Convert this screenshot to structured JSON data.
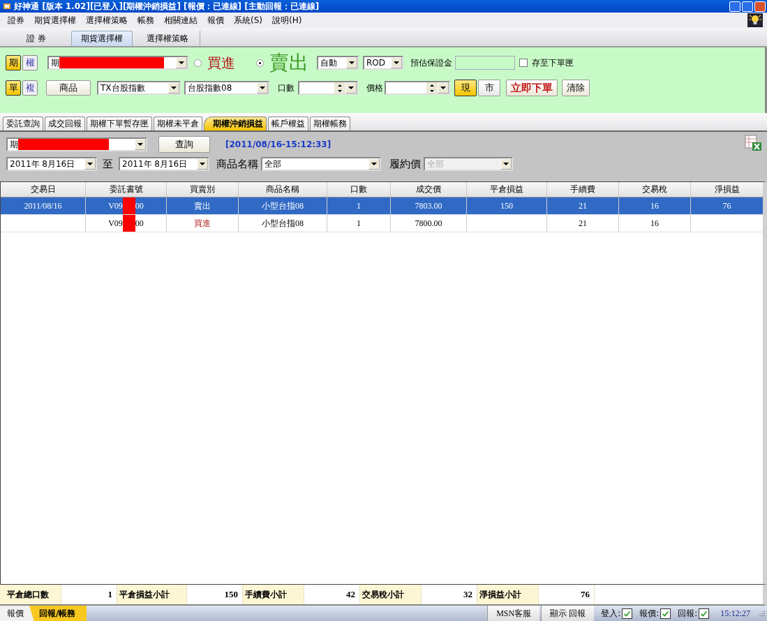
{
  "window": {
    "title": "好神通 [版本 1.02][已登入][期權沖銷損益] [報價：已連線] [主動回報：已連線]"
  },
  "menu": [
    "證券",
    "期貨選擇權",
    "選擇權策略",
    "帳務",
    "相關連結",
    "報價",
    "系統(S)",
    "說明(H)"
  ],
  "top_tabs": [
    {
      "label": "證 券",
      "selected": false
    },
    {
      "label": "期貨選擇權",
      "selected": true
    },
    {
      "label": "選擇權策略",
      "selected": false
    }
  ],
  "order_panel": {
    "market_toggle": [
      {
        "label": "期",
        "selected": true
      },
      {
        "label": "權",
        "selected": false
      }
    ],
    "account": {
      "value": "期"
    },
    "side": [
      {
        "label": "買進",
        "selected": false
      },
      {
        "label": "賣出",
        "selected": true
      }
    ],
    "order_type": {
      "value": "自動"
    },
    "time_in_force": {
      "value": "ROD"
    },
    "margin_label": "預估保證金",
    "save_to_draft": {
      "label": "存至下單匣",
      "checked": false
    },
    "mode_toggle": [
      {
        "label": "單",
        "selected": true
      },
      {
        "label": "複",
        "selected": false
      }
    ],
    "product_button": "商品",
    "product": {
      "value": "TX台股指數"
    },
    "contract": {
      "value": "台股指數08"
    },
    "quantity_label": "口數",
    "price_label": "價格",
    "price_type": [
      {
        "label": "現",
        "selected": true
      },
      {
        "label": "市",
        "selected": false
      }
    ],
    "submit_button": "立即下單",
    "clear_button": "清除"
  },
  "sub_tabs": [
    {
      "label": "委託查詢",
      "selected": false
    },
    {
      "label": "成交回報",
      "selected": false
    },
    {
      "label": "期權下單暫存匣",
      "selected": false
    },
    {
      "label": "期權未平倉",
      "selected": false
    },
    {
      "label": "期權沖銷損益",
      "selected": true
    },
    {
      "label": "帳戶權益",
      "selected": false
    },
    {
      "label": "期權帳務",
      "selected": false
    }
  ],
  "filter": {
    "account": {
      "value": "期"
    },
    "query_button": "查詢",
    "timestamp": "[2011/08/16-15:12:33]",
    "date_from": {
      "value": "2011年  8月16日"
    },
    "to_label": "至",
    "date_to": {
      "value": "2011年  8月16日"
    },
    "product_label": "商品名稱",
    "product": {
      "value": "全部"
    },
    "strike_label": "履約價",
    "strike": {
      "value": "全部",
      "disabled": true
    }
  },
  "table": {
    "columns": [
      "交易日",
      "委託書號",
      "買賣別",
      "商品名稱",
      "口數",
      "成交價",
      "平倉損益",
      "手續費",
      "交易稅",
      "淨損益"
    ],
    "rows": [
      {
        "selected": true,
        "date": "2011/08/16",
        "order_no": [
          "V09",
          "00"
        ],
        "side": "賣出",
        "product": "小型台指08",
        "qty": "1",
        "price": "7803.00",
        "pnl": "150",
        "fee": "21",
        "tax": "16",
        "net": "76"
      },
      {
        "selected": false,
        "order_no": [
          "V09",
          "00"
        ],
        "side": "買進",
        "product": "小型台指08",
        "qty": "1",
        "price": "7800.00",
        "fee": "21",
        "tax": "16"
      }
    ]
  },
  "summary": [
    {
      "label": "平倉總口數",
      "value": "1"
    },
    {
      "label": "平倉損益小計",
      "value": "150"
    },
    {
      "label": "手續費小計",
      "value": "42"
    },
    {
      "label": "交易稅小計",
      "value": "32"
    },
    {
      "label": "淨損益小計",
      "value": "76"
    }
  ],
  "status_bar": {
    "tabs": [
      {
        "label": "報價",
        "selected": false
      },
      {
        "label": "回報/帳務",
        "selected": true
      }
    ],
    "buttons": [
      "MSN客服",
      "顯示 回報"
    ],
    "indicators": [
      {
        "label": "登入:",
        "checked": true
      },
      {
        "label": "報價:",
        "checked": true
      },
      {
        "label": "回報:",
        "checked": true
      }
    ],
    "time": "15:12:27"
  }
}
